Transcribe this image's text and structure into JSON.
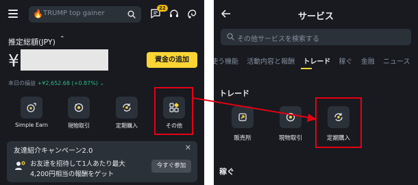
{
  "left": {
    "search": {
      "placeholder": "TRUMP top gainer"
    },
    "notification_count": "22",
    "estimated_label": "推定総額(JPY)",
    "currency_symbol": "¥",
    "deposit_button": "資金の追加",
    "pnl_label": "本日の損益",
    "pnl_value": "+¥2,652.68 (+0.87%)",
    "pnl_chevron": "⌄",
    "actions": [
      {
        "label": "Simple Earn",
        "icon": "simple-earn-icon"
      },
      {
        "label": "現物取引",
        "icon": "spot-trade-icon"
      },
      {
        "label": "定期購入",
        "icon": "recurring-buy-icon"
      },
      {
        "label": "その他",
        "icon": "more-grid-icon"
      }
    ],
    "promo": {
      "title": "友達紹介キャンペーン2.0",
      "line1": "お友達を招待して1人あたり最大",
      "line2": "4,200円相当の報酬をゲット",
      "button": "今すぐ参加",
      "close": "✕"
    }
  },
  "right": {
    "title": "サービス",
    "search_placeholder": "その他サービスを検索する",
    "tabs": [
      "使う機能",
      "活動内容と報酬",
      "トレード",
      "稼ぐ",
      "金融",
      "ニュース"
    ],
    "active_tab": 2,
    "section_trade": "トレード",
    "trade_items": [
      {
        "label": "販売所",
        "icon": "exchange-shop-icon"
      },
      {
        "label": "現物取引",
        "icon": "spot-trade-icon"
      },
      {
        "label": "定期購入",
        "icon": "recurring-buy-icon"
      }
    ],
    "section_earn": "稼ぐ"
  },
  "colors": {
    "background": "#181a20",
    "card": "#2b3139",
    "accent_yellow": "#fcd535",
    "profit_green": "#2ebd85",
    "highlight_red": "#e60012"
  }
}
